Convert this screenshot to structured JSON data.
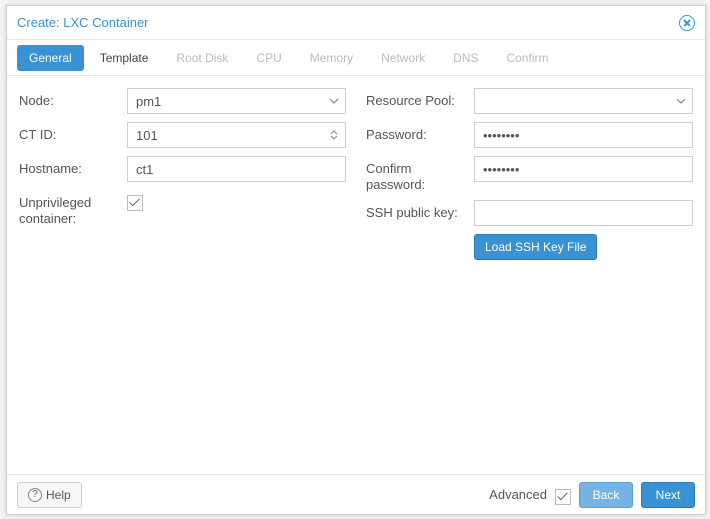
{
  "title": "Create: LXC Container",
  "tabs": [
    {
      "label": "General",
      "state": "active"
    },
    {
      "label": "Template",
      "state": "enabled"
    },
    {
      "label": "Root Disk",
      "state": "disabled"
    },
    {
      "label": "CPU",
      "state": "disabled"
    },
    {
      "label": "Memory",
      "state": "disabled"
    },
    {
      "label": "Network",
      "state": "disabled"
    },
    {
      "label": "DNS",
      "state": "disabled"
    },
    {
      "label": "Confirm",
      "state": "disabled"
    }
  ],
  "left": {
    "node_label": "Node:",
    "node_value": "pm1",
    "ctid_label": "CT ID:",
    "ctid_value": "101",
    "hostname_label": "Hostname:",
    "hostname_value": "ct1",
    "unpriv_label": "Unprivileged container:",
    "unpriv_checked": true
  },
  "right": {
    "pool_label": "Resource Pool:",
    "pool_value": "",
    "password_label": "Password:",
    "password_value": "••••••••",
    "confirm_label": "Confirm password:",
    "confirm_value": "••••••••",
    "sshkey_label": "SSH public key:",
    "sshkey_value": "",
    "loadssh_label": "Load SSH Key File"
  },
  "footer": {
    "help_label": "Help",
    "advanced_label": "Advanced",
    "advanced_checked": true,
    "back_label": "Back",
    "next_label": "Next"
  }
}
